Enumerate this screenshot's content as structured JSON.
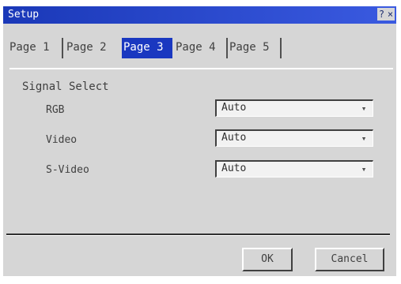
{
  "window": {
    "title": "Setup",
    "help_label": "?",
    "close_label": "×"
  },
  "tabs": [
    {
      "label": "Page 1",
      "active": false
    },
    {
      "label": "Page 2",
      "active": false
    },
    {
      "label": "Page 3",
      "active": true
    },
    {
      "label": "Page 4",
      "active": false
    },
    {
      "label": "Page 5",
      "active": false
    }
  ],
  "signal_select": {
    "title": "Signal Select",
    "rows": [
      {
        "label": "RGB",
        "value": "Auto"
      },
      {
        "label": "Video",
        "value": "Auto"
      },
      {
        "label": "S-Video",
        "value": "Auto"
      }
    ],
    "dropdown_icon": "dropdown-arrow-icon"
  },
  "buttons": {
    "ok_label": "OK",
    "cancel_label": "Cancel"
  },
  "colors": {
    "title_bar": "#1a38b8",
    "active_tab": "#1a38c0",
    "dialog_background": "#d6d6d6"
  }
}
